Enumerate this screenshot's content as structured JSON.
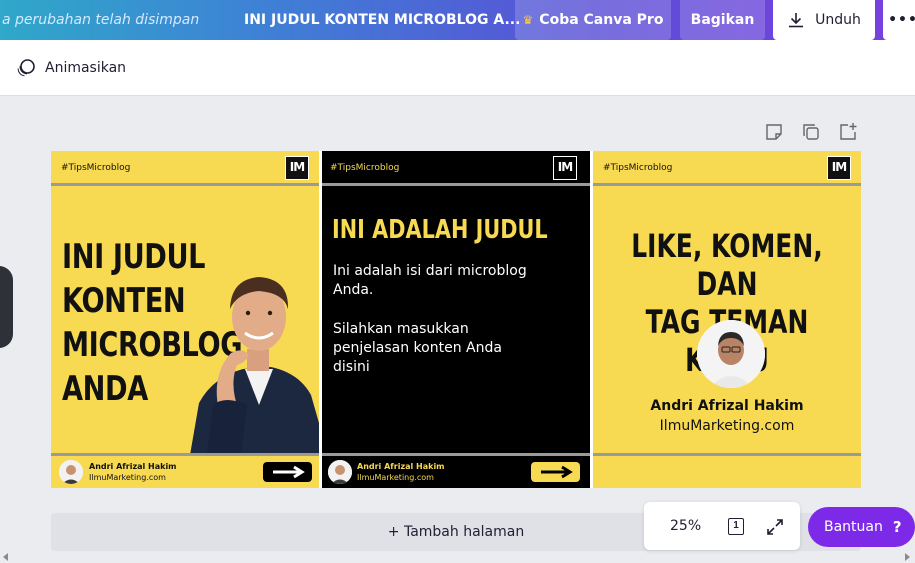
{
  "topbar": {
    "saved_status": "a perubahan telah disimpan",
    "document_title": "INI JUDUL KONTEN MICROBLOG A...",
    "try_pro_label": "Coba Canva Pro",
    "share_label": "Bagikan",
    "download_label": "Unduh",
    "more_label": "•••"
  },
  "subbar": {
    "animate_label": "Animasikan"
  },
  "slides": [
    {
      "hashtag": "#TipsMicroblog",
      "logo": "IM",
      "title": "INI JUDUL\nKONTEN\nMICROBLOG\nANDA",
      "footer_name": "Andri Afrizal Hakim",
      "footer_site": "IlmuMarketing.com"
    },
    {
      "hashtag": "#TipsMicroblog",
      "logo": "IM",
      "title": "INI ADALAH JUDUL",
      "body1": "Ini adalah isi dari microblog Anda.",
      "body2": "Silahkan masukkan penjelasan konten Anda disini",
      "footer_name": "Andri Afrizal Hakim",
      "footer_site": "IlmuMarketing.com"
    },
    {
      "hashtag": "#TipsMicroblog",
      "logo": "IM",
      "title_line1": "LIKE, KOMEN, DAN",
      "title_line2": "TAG TEMAN KAMU",
      "name": "Andri Afrizal Hakim",
      "site": "IlmuMarketing.com"
    }
  ],
  "add_page_label": "+ Tambah halaman",
  "zoom": {
    "value": "25%",
    "page_number": "1"
  },
  "help": {
    "label": "Bantuan",
    "symbol": "?"
  },
  "colors": {
    "accent": "#7d2ae8",
    "slide_yellow": "#f8da52",
    "slide_black": "#000000"
  }
}
